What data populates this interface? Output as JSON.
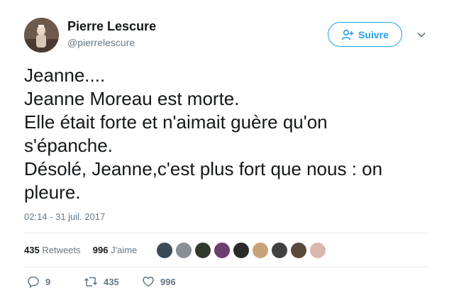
{
  "author": {
    "name": "Pierre Lescure",
    "handle": "@pierrelescure"
  },
  "follow_button": {
    "label": "Suivre",
    "icon": "add-user-icon"
  },
  "menu_icon": "chevron-down-icon",
  "tweet": {
    "text": "Jeanne....\nJeanne Moreau est morte.\nElle était forte et n'aimait guère qu'on\ns'épanche.\nDésolé, Jeanne,c'est plus fort que nous : on\npleure.",
    "timestamp": "02:14 - 31 juil. 2017"
  },
  "stats": {
    "retweets_count": "435",
    "retweets_label": "Retweets",
    "likes_count": "996",
    "likes_label": "J'aime"
  },
  "likers": {
    "colors": [
      "#3b4a5a",
      "#8a8f96",
      "#2f3a2c",
      "#6b3f6f",
      "#2a2a2a",
      "#c9a27a",
      "#404040",
      "#5a4a3a",
      "#d8b8b0"
    ]
  },
  "actions": {
    "reply_count": "9",
    "retweet_count": "435",
    "like_count": "996"
  },
  "colors": {
    "accent": "#1da1f2",
    "secondary_text": "#657786",
    "primary_text": "#14171a",
    "divider": "#e6ecf0"
  }
}
